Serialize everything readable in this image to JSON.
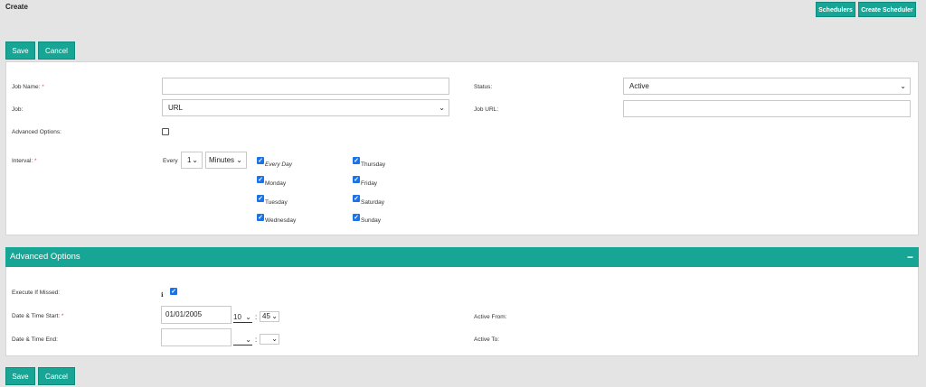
{
  "page": {
    "title": "Create"
  },
  "toolbar": {
    "schedulers_label": "Schedulers",
    "create_scheduler_label": "Create Scheduler"
  },
  "actions": {
    "save_label": "Save",
    "cancel_label": "Cancel"
  },
  "form": {
    "job_name_label": "Job Name:",
    "required_mark": "*",
    "job_name_value": "",
    "status_label": "Status:",
    "status_value": "Active",
    "job_label": "Job:",
    "job_value": "URL",
    "job_url_label": "Job URL:",
    "job_url_value": "",
    "advanced_options_label": "Advanced Options:",
    "advanced_options_checked": false,
    "interval_label": "Interval:",
    "every_label": "Every",
    "interval_value": "1",
    "interval_unit": "Minutes",
    "days": [
      {
        "label": "Every Day",
        "checked": true
      },
      {
        "label": "Monday",
        "checked": true
      },
      {
        "label": "Tuesday",
        "checked": true
      },
      {
        "label": "Wednesday",
        "checked": true
      },
      {
        "label": "Thursday",
        "checked": true
      },
      {
        "label": "Friday",
        "checked": true
      },
      {
        "label": "Saturday",
        "checked": true
      },
      {
        "label": "Sunday",
        "checked": true
      }
    ]
  },
  "advanced": {
    "header": "Advanced Options",
    "collapse_glyph": "−",
    "execute_if_missed_label": "Execute If Missed:",
    "info_glyph": "ℹ",
    "execute_if_missed_checked": true,
    "start_label": "Date & Time Start:",
    "start_date": "01/01/2005",
    "start_hour": "10",
    "start_minute": "45",
    "end_label": "Date & Time End:",
    "end_date": "",
    "time_separator": ":",
    "active_from_label": "Active From:",
    "active_to_label": "Active To:"
  },
  "icons": {
    "chevron": "chevron-down-icon",
    "checkmark": "check-icon",
    "info": "info-icon",
    "collapse": "minus-icon"
  },
  "colors": {
    "accent": "#17a596",
    "checkbox": "#1a73e8",
    "required": "#d9534f"
  }
}
